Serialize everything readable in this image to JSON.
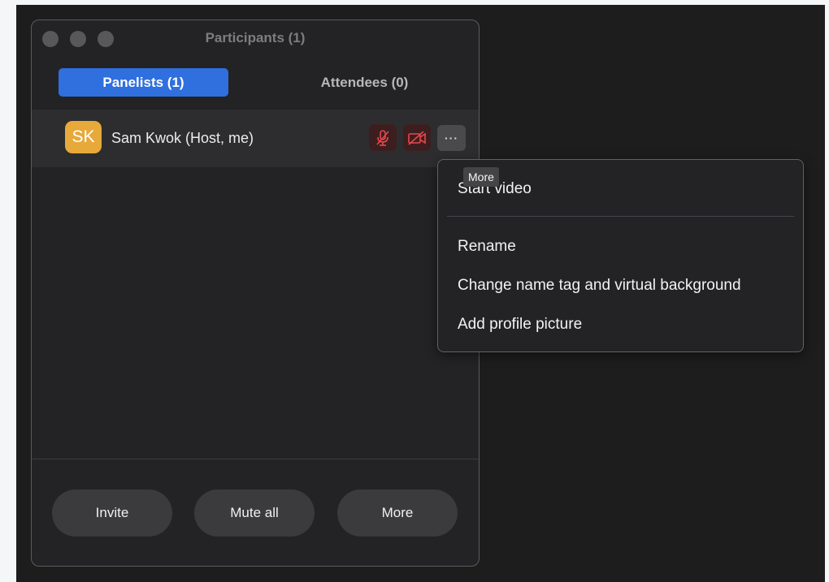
{
  "window": {
    "title": "Participants (1)"
  },
  "tabs": [
    {
      "label": "Panelists (1)",
      "active": true
    },
    {
      "label": "Attendees (0)",
      "active": false
    }
  ],
  "participants": [
    {
      "initials": "SK",
      "name": "Sam Kwok (Host, me)",
      "avatar_color": "#e7a93a",
      "audio_muted": true,
      "video_off": true
    }
  ],
  "footer": {
    "invite_label": "Invite",
    "mute_all_label": "Mute all",
    "more_label": "More"
  },
  "tooltip": {
    "text": "More"
  },
  "context_menu": {
    "items": [
      {
        "label": "Start video"
      },
      {
        "label": "Rename"
      },
      {
        "label": "Change name tag and virtual background"
      },
      {
        "label": "Add profile picture"
      }
    ]
  },
  "colors": {
    "accent": "#2f6fde",
    "muted_red": "#e5484d",
    "panel_bg": "#232325"
  },
  "icons": {
    "mic": "mic-muted-icon",
    "video": "video-off-icon",
    "more": "ellipsis-icon"
  }
}
